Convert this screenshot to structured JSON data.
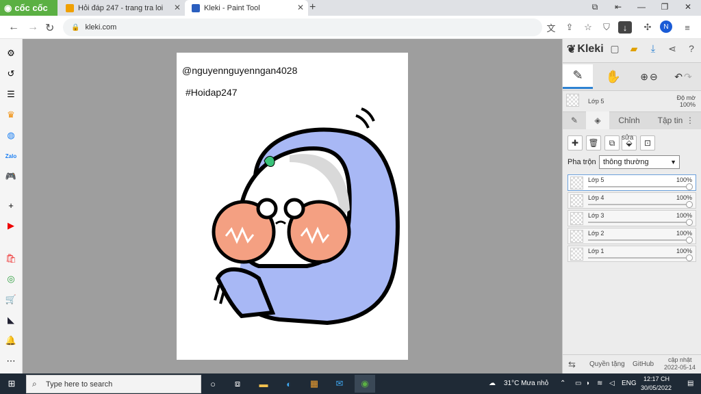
{
  "browser": {
    "brand": "cốc cốc",
    "tabs": [
      {
        "title": "Hỏi đáp 247 - trang tra loi",
        "active": false
      },
      {
        "title": "Kleki - Paint Tool",
        "active": true
      }
    ],
    "url": "kleki.com",
    "avatar_letter": "N"
  },
  "canvas": {
    "text_line1": "@nguyennguyenngan4028",
    "text_line2": "#Hoidap247"
  },
  "kleki": {
    "logo": "Kleki",
    "layer_header": {
      "name": "Lớp 5",
      "opacity_label": "Độ mờ",
      "opacity_value": "100%"
    },
    "tabs": [
      "Chỉnh",
      "Tập tin"
    ],
    "layer_buttons": {
      "edit_label": "sửa"
    },
    "blend_label": "Pha trộn",
    "blend_value": "thông thường",
    "layers": [
      {
        "name": "Lớp 5",
        "opacity": "100%",
        "selected": true
      },
      {
        "name": "Lớp 4",
        "opacity": "100%",
        "selected": false
      },
      {
        "name": "Lớp 3",
        "opacity": "100%",
        "selected": false
      },
      {
        "name": "Lớp 2",
        "opacity": "100%",
        "selected": false
      },
      {
        "name": "Lớp 1",
        "opacity": "100%",
        "selected": false
      }
    ],
    "footer": {
      "privacy": "Quyền tặng",
      "github": "GitHub",
      "update_label": "cập nhật",
      "update_date": "2022-05-14"
    }
  },
  "taskbar": {
    "search_placeholder": "Type here to search",
    "weather": "31°C  Mưa nhỏ",
    "lang": "ENG",
    "time": "12:17 CH",
    "date": "30/05/2022"
  },
  "colors": {
    "accent": "#2d82d2",
    "brand": "#5bb043",
    "hood": "#a8b8f5",
    "cheek": "#f4a082"
  }
}
